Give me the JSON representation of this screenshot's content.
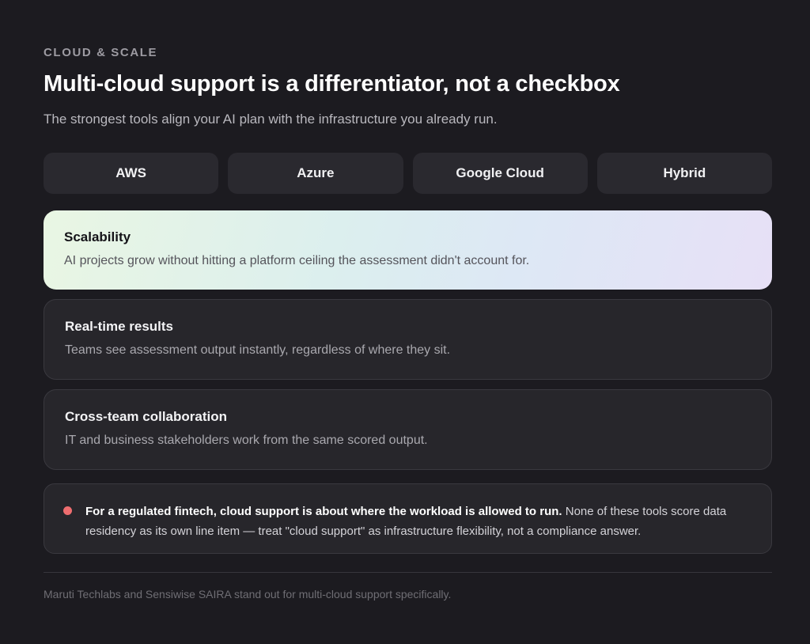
{
  "header": {
    "eyebrow": "CLOUD & SCALE",
    "title": "Multi-cloud support is a differentiator, not a checkbox",
    "subtitle": "The strongest tools align your AI plan with the infrastructure you already run."
  },
  "tabs": [
    {
      "label": "AWS"
    },
    {
      "label": "Azure"
    },
    {
      "label": "Google Cloud"
    },
    {
      "label": "Hybrid"
    }
  ],
  "cards": [
    {
      "title": "Scalability",
      "description": "AI projects grow without hitting a platform ceiling the assessment didn't account for."
    },
    {
      "title": "Real-time results",
      "description": "Teams see assessment output instantly, regardless of where they sit."
    },
    {
      "title": "Cross-team collaboration",
      "description": "IT and business stakeholders work from the same scored output."
    }
  ],
  "note": {
    "bold": "For a regulated fintech, cloud support is about where the workload is allowed to run.",
    "text": " None of these tools score data residency as its own line item — treat \"cloud support\" as infrastructure flexibility, not a compliance answer.",
    "dot_color": "#ee6d6f"
  },
  "footnote": "Maruti Techlabs and Sensiwise SAIRA stand out for multi-cloud support specifically.",
  "colors": {
    "background": "#1c1b20",
    "card": "#27262b",
    "accent_gradient": [
      "#e9f6e3",
      "#dcefee",
      "#e7e0f6"
    ]
  }
}
